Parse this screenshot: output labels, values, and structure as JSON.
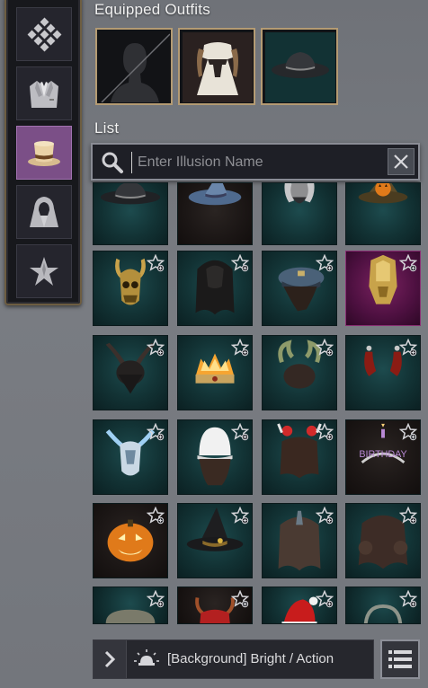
{
  "panel": {
    "equipped_title": "Equipped Outfits",
    "list_title": "List"
  },
  "categories": [
    {
      "name": "all-category",
      "icon": "diamond-pattern-icon",
      "active": false
    },
    {
      "name": "outfit-category",
      "icon": "suit-jacket-icon",
      "active": false
    },
    {
      "name": "hat-category",
      "icon": "top-hat-icon",
      "active": true
    },
    {
      "name": "cloak-category",
      "icon": "hooded-cloak-icon",
      "active": false
    },
    {
      "name": "special-category",
      "icon": "star-burst-icon",
      "active": false
    }
  ],
  "equipped": [
    {
      "slot": "body-slot",
      "state": "empty",
      "icon": "mannequin-head-icon"
    },
    {
      "slot": "outfit-slot",
      "state": "equipped",
      "icon": "white-dress-outfit-icon"
    },
    {
      "slot": "hat-slot",
      "state": "equipped",
      "icon": "black-wide-brim-hat-icon"
    }
  ],
  "search": {
    "placeholder": "Enter Illusion Name",
    "value": ""
  },
  "items": [
    {
      "icon": "black-wide-brim-hat-icon",
      "bg": "teal"
    },
    {
      "icon": "blue-witch-hat-icon",
      "bg": "dark"
    },
    {
      "icon": "horned-skull-headdress-icon",
      "bg": "teal"
    },
    {
      "icon": "pumpkin-witch-hat-icon",
      "bg": "teal"
    },
    {
      "icon": "golden-horned-skull-mask-icon",
      "bg": "teal"
    },
    {
      "icon": "dark-long-hair-icon",
      "bg": "teal"
    },
    {
      "icon": "blue-military-cap-icon",
      "bg": "teal"
    },
    {
      "icon": "golden-dragon-helm-icon",
      "bg": "purple"
    },
    {
      "icon": "dark-horned-headdress-icon",
      "bg": "teal"
    },
    {
      "icon": "flaming-crown-icon",
      "bg": "teal"
    },
    {
      "icon": "antler-horns-icon",
      "bg": "teal"
    },
    {
      "icon": "red-earrings-icon",
      "bg": "teal"
    },
    {
      "icon": "ice-antler-helm-icon",
      "bg": "teal"
    },
    {
      "icon": "white-fur-hat-icon",
      "bg": "teal"
    },
    {
      "icon": "reindeer-headband-icon",
      "bg": "teal"
    },
    {
      "icon": "birthday-headband-icon",
      "bg": "dark"
    },
    {
      "icon": "jack-o-lantern-icon",
      "bg": "dark"
    },
    {
      "icon": "black-witch-hat-icon",
      "bg": "teal"
    },
    {
      "icon": "veiled-hair-icon",
      "bg": "teal"
    },
    {
      "icon": "brown-curly-hair-icon",
      "bg": "teal"
    },
    {
      "icon": "knit-cap-icon",
      "bg": "teal"
    },
    {
      "icon": "red-antler-cap-icon",
      "bg": "dark"
    },
    {
      "icon": "santa-hat-icon",
      "bg": "teal"
    },
    {
      "icon": "headphones-icon",
      "bg": "teal"
    }
  ],
  "birthday_text": "BIRTHDAY",
  "footer": {
    "background_label": "[Background] Bright / Action"
  },
  "colors": {
    "active_category": "#7b4f87",
    "slot_border": "#b49b73",
    "item_teal": "#123234"
  }
}
